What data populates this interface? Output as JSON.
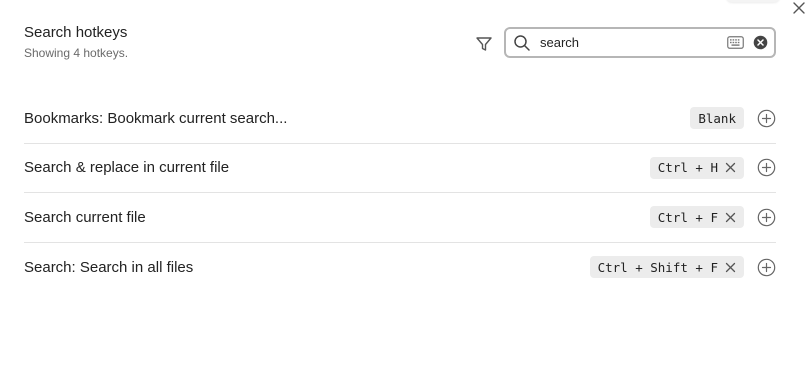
{
  "header": {
    "title": "Search hotkeys",
    "subtitle": "Showing 4 hotkeys."
  },
  "search": {
    "value": "search",
    "placeholder": "Filter..."
  },
  "hotkeys": [
    {
      "label": "Bookmarks: Bookmark current search...",
      "keys": "Blank",
      "removable": false
    },
    {
      "label": "Search & replace in current file",
      "keys": "Ctrl + H",
      "removable": true
    },
    {
      "label": "Search current file",
      "keys": "Ctrl + F",
      "removable": true
    },
    {
      "label": "Search: Search in all files",
      "keys": "Ctrl + Shift + F",
      "removable": true
    }
  ],
  "icons": {
    "close": "close-icon",
    "filter": "filter-icon",
    "search": "search-icon",
    "keyboard": "keyboard-icon",
    "clear": "clear-search-icon",
    "remove": "remove-hotkey-icon",
    "add": "add-hotkey-icon"
  },
  "colors": {
    "chip_bg": "#ececec",
    "divider": "#e3e3e3",
    "search_border": "#b6b6b6",
    "muted_text": "#6b6b6b"
  }
}
